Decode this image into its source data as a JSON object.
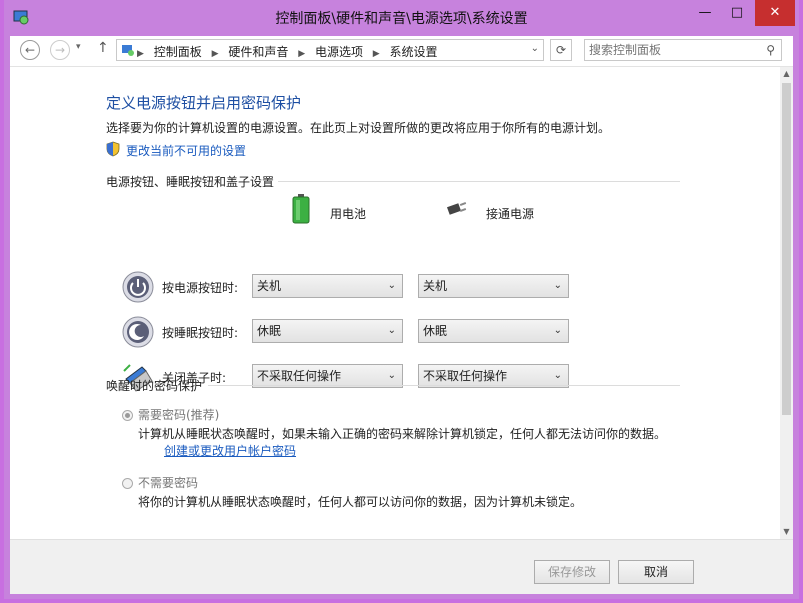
{
  "window": {
    "title": "控制面板\\硬件和声音\\电源选项\\系统设置",
    "minimize": "—",
    "maximize": "□",
    "close": "✕"
  },
  "address": {
    "crumbs": [
      "控制面板",
      "硬件和声音",
      "电源选项",
      "系统设置"
    ],
    "search_placeholder": "搜索控制面板"
  },
  "main": {
    "title": "定义电源按钮并启用密码保护",
    "description": "选择要为你的计算机设置的电源设置。在此页上对设置所做的更改将应用于你所有的电源计划。",
    "change_link": "更改当前不可用的设置",
    "section_buttons": "电源按钮、睡眠按钮和盖子设置",
    "col_battery": "用电池",
    "col_plugged": "接通电源",
    "rows": [
      {
        "label": "按电源按钮时:",
        "battery": "关机",
        "plugged": "关机"
      },
      {
        "label": "按睡眠按钮时:",
        "battery": "休眠",
        "plugged": "休眠"
      },
      {
        "label": "关闭盖子时:",
        "battery": "不采取任何操作",
        "plugged": "不采取任何操作"
      }
    ],
    "section_password": "唤醒时的密码保护",
    "opt_require": "需要密码(推荐)",
    "opt_require_desc": "计算机从睡眠状态唤醒时，如果未输入正确的密码来解除计算机锁定，任何人都无法访问你的数据。",
    "opt_require_link": "创建或更改用户帐户密码",
    "opt_none": "不需要密码",
    "opt_none_desc": "将你的计算机从睡眠状态唤醒时，任何人都可以访问你的数据，因为计算机未锁定。"
  },
  "footer": {
    "save": "保存修改",
    "cancel": "取消"
  },
  "colors": {
    "frame": "#c782dd",
    "link": "#1a5bbf",
    "heading": "#1e4fa3",
    "close": "#c62f2f"
  }
}
